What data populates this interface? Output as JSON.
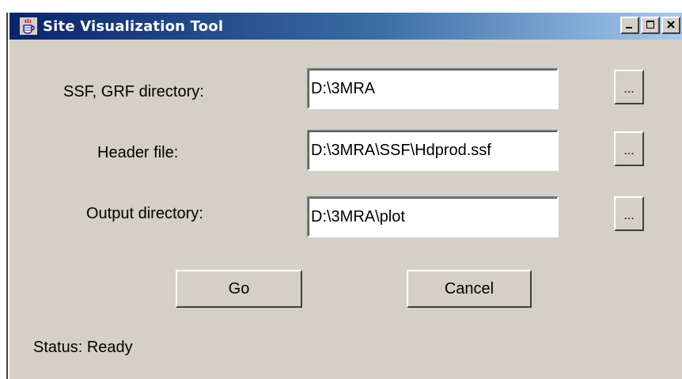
{
  "window": {
    "title": "Site Visualization Tool",
    "icon": "java-cup-icon",
    "controls": {
      "minimize": "_",
      "maximize": "□",
      "close": "×"
    }
  },
  "form": {
    "rows": [
      {
        "label": "SSF, GRF directory:",
        "value": "D:\\3MRA",
        "browse_label": "..."
      },
      {
        "label": "Header file:",
        "value": "D:\\3MRA\\SSF\\Hdprod.ssf",
        "browse_label": "..."
      },
      {
        "label": "Output directory:",
        "value": "D:\\3MRA\\plot",
        "browse_label": "..."
      }
    ]
  },
  "actions": {
    "go_label": "Go",
    "cancel_label": "Cancel"
  },
  "status": {
    "text": "Status: Ready"
  },
  "colors": {
    "window_bg": "#d4d0c8",
    "title_gradient_start": "#0a246a",
    "title_gradient_end": "#a6caf0",
    "field_bg": "#ffffff"
  }
}
